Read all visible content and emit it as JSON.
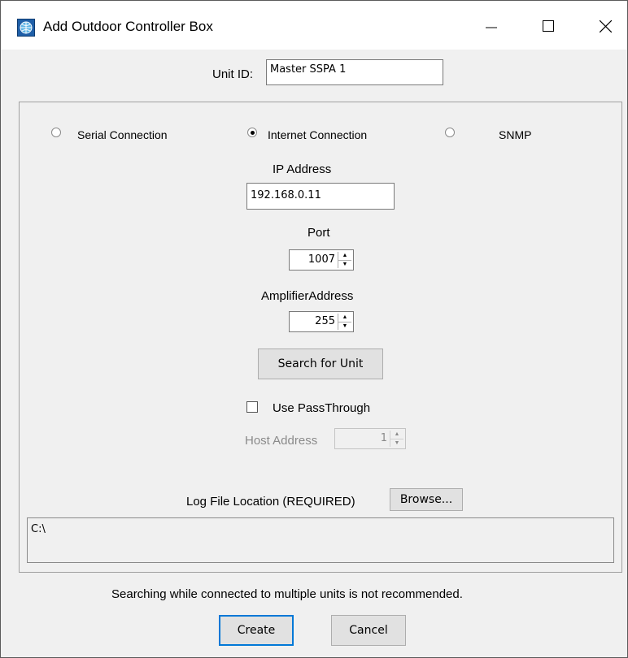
{
  "window": {
    "title": "Add Outdoor Controller Box",
    "minimize_symbol": "—",
    "maximize_symbol": "☐",
    "close_symbol": "✕"
  },
  "unit_id": {
    "label": "Unit ID:",
    "value": "Master SSPA 1"
  },
  "connection": {
    "serial_label": "Serial Connection",
    "internet_label": "Internet Connection",
    "snmp_label": "SNMP",
    "selected": "internet"
  },
  "ip": {
    "label": "IP Address",
    "value": "192.168.0.11"
  },
  "port": {
    "label": "Port",
    "value": "1007"
  },
  "amp": {
    "label": "AmplifierAddress",
    "value": "255"
  },
  "search_button": "Search for Unit",
  "passthrough": {
    "label": "Use PassThrough",
    "checked": false
  },
  "host": {
    "label": "Host Address",
    "value": "1"
  },
  "log": {
    "label": "Log File Location (REQUIRED)",
    "browse": "Browse...",
    "path": "C:\\"
  },
  "warning": "Searching while connected to multiple units is not recommended.",
  "buttons": {
    "create": "Create",
    "cancel": "Cancel"
  },
  "icons": {
    "app": "network-icon",
    "spin_up": "up-arrow-icon",
    "spin_down": "down-arrow-icon"
  }
}
